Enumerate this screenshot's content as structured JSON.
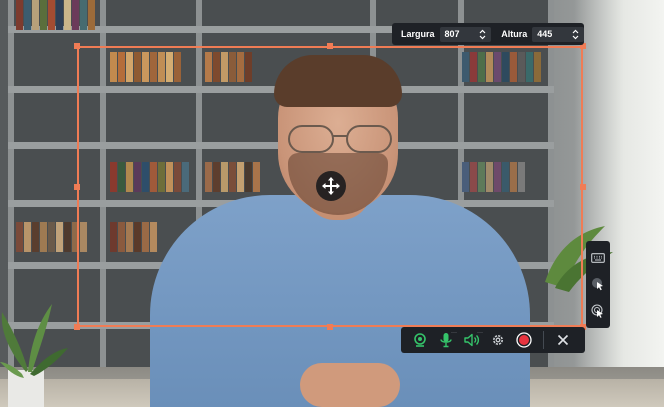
{
  "size_bar": {
    "width_label": "Largura",
    "width_value": "807",
    "height_label": "Altura",
    "height_value": "445"
  },
  "icons": {
    "move": "move-arrows-icon",
    "webcam": "webcam-icon",
    "microphone": "microphone-icon",
    "speaker": "speaker-icon",
    "settings": "gear-icon",
    "record": "record-icon",
    "close": "close-icon",
    "keyboard": "keyboard-icon",
    "cursor_highlight": "cursor-highlight-icon",
    "click_effect": "click-effect-icon"
  },
  "colors": {
    "frame": "#f07c55",
    "toolbar_bg": "#1e2126",
    "active_green": "#35c46a",
    "record_red": "#e8343f"
  }
}
